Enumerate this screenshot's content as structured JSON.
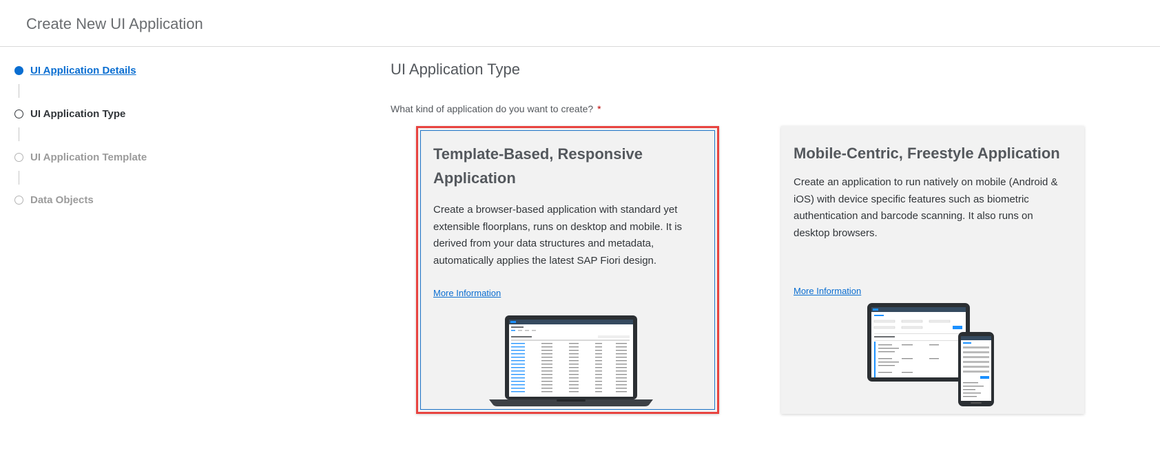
{
  "header": {
    "title": "Create New UI Application"
  },
  "wizard": {
    "steps": [
      {
        "label": "UI Application Details",
        "state": "completed"
      },
      {
        "label": "UI Application Type",
        "state": "current"
      },
      {
        "label": "UI Application Template",
        "state": "disabled"
      },
      {
        "label": "Data Objects",
        "state": "disabled"
      }
    ]
  },
  "main": {
    "section_title": "UI Application Type",
    "question": "What kind of application do you want to create?",
    "required_marker": "*",
    "cards": [
      {
        "title": "Template-Based, Responsive Application",
        "description": "Create a browser-based application with standard yet extensible floorplans, runs on desktop and mobile. It is derived from your data structures and metadata, automatically applies the latest SAP Fiori design.",
        "link": "More Information",
        "illustration": "laptop-icon",
        "selected": true
      },
      {
        "title": "Mobile-Centric, Freestyle Application",
        "description": "Create an application to run natively on mobile (Android & iOS) with device specific features such as biometric authentication and barcode scanning. It also runs on desktop browsers.",
        "link": "More Information",
        "illustration": "tablet-phone-icon",
        "selected": false
      }
    ]
  },
  "colors": {
    "accent": "#0a6ed1",
    "selection_border": "#e8433f",
    "card_background": "#f2f2f2",
    "required": "#bb0000"
  }
}
